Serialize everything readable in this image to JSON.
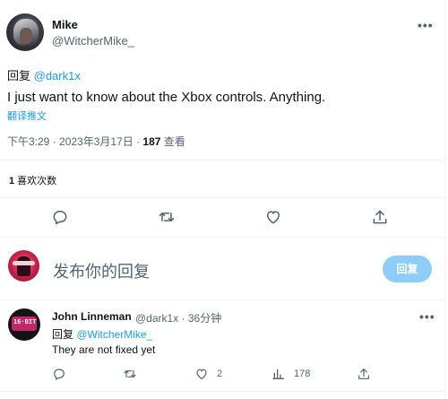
{
  "tweet": {
    "author_name": "Mike",
    "author_handle": "@WitcherMike_",
    "more_icon": "more-dots-icon",
    "reply_prefix": "回复 ",
    "reply_to": "@dark1x",
    "text": "I just want to know about the Xbox controls. Anything.",
    "translate": "翻译推文",
    "time": "下午3:29 · 2023年3月17日 · ",
    "views_count": "187",
    "views_label": " 查看",
    "likes_count": "1",
    "likes_label": " 喜欢次数",
    "actions": [
      "reply-icon",
      "retweet-icon",
      "like-icon",
      "share-icon"
    ]
  },
  "composer": {
    "placeholder": "发布你的回复",
    "button_label": "回复",
    "button_color": "#8ecdf8"
  },
  "reply": {
    "author_name": "John Linneman",
    "author_meta": "@dark1x · 36分钟",
    "avatar_label": "16·BIT",
    "reply_prefix": "回复 ",
    "reply_to": "@WitcherMike_",
    "text": "They are not fixed yet",
    "likes": "2",
    "views": "178"
  },
  "colors": {
    "accent": "#1d9bf0",
    "muted": "#536471",
    "divider": "#eff3f4"
  }
}
